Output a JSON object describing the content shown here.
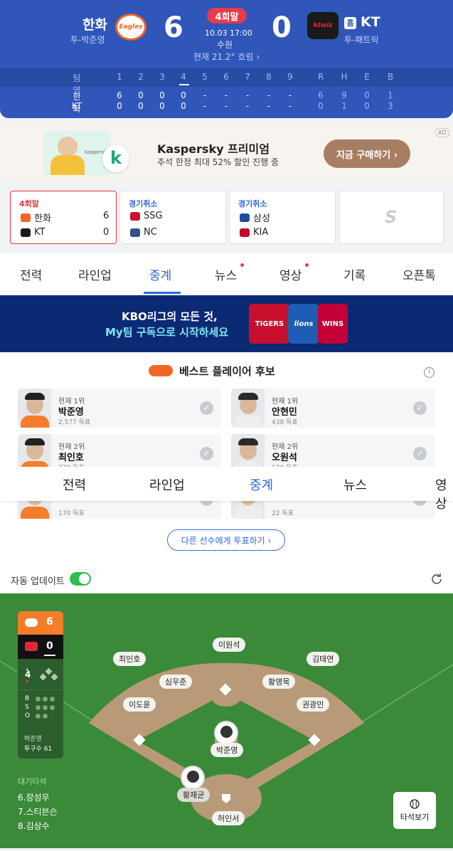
{
  "scoreboard": {
    "away": {
      "name": "한화",
      "pitcher": "투-박준영",
      "score": "6",
      "logo_text": "Eagles"
    },
    "home": {
      "name": "KT",
      "pitcher": "투-패트릭",
      "score": "0",
      "logo_text": "ktwiz",
      "home_badge": "홈"
    },
    "inning": "4회말",
    "datetime": "10.03 17:00",
    "stadium": "수원",
    "weather": "현재 21.2° 흐림 ›",
    "linescore": {
      "header": [
        "팀명",
        "1",
        "2",
        "3",
        "4",
        "5",
        "6",
        "7",
        "8",
        "9",
        "R",
        "H",
        "E",
        "B"
      ],
      "rows": [
        [
          "한화",
          "6",
          "0",
          "0",
          "0",
          "-",
          "-",
          "-",
          "-",
          "-",
          "6",
          "9",
          "0",
          "1"
        ],
        [
          "KT",
          "0",
          "0",
          "0",
          "0",
          "-",
          "-",
          "-",
          "-",
          "-",
          "0",
          "1",
          "0",
          "3"
        ]
      ]
    }
  },
  "ad": {
    "title": "Kaspersky 프리미엄",
    "subtitle": "추석 한정 최대 52% 할인 진행 중",
    "button": "지금 구매하기 ›",
    "badge": "AD",
    "brand": "kaspersky",
    "brand_mark": "k"
  },
  "games": [
    {
      "status": "4회말",
      "team1": "한화",
      "score1": "6",
      "team2": "KT",
      "score2": "0"
    },
    {
      "status": "경기취소",
      "team1": "SSG",
      "team2": "NC"
    },
    {
      "status": "경기취소",
      "team1": "삼성",
      "team2": "KIA"
    },
    {
      "status": "",
      "logo": "S"
    }
  ],
  "tabs": [
    "전력",
    "라인업",
    "중계",
    "뉴스",
    "영상",
    "기록",
    "오픈톡"
  ],
  "sticky_tabs": [
    "전력",
    "라인업",
    "중계",
    "뉴스",
    "영상"
  ],
  "banner": {
    "line1": "KBO리그의 모든 것,",
    "line2": "My팀 구독으로 시작하세요",
    "t1": "TIGERS",
    "t2": "lions",
    "t3": "WINS"
  },
  "best_players": {
    "title": "베스트 플레이어 후보",
    "cards": [
      {
        "rank": "현재 1위",
        "name": "박준영",
        "votes": "2,577 득표"
      },
      {
        "rank": "현재 1위",
        "name": "안현민",
        "votes": "438 득표"
      },
      {
        "rank": "현재 2위",
        "name": "최인호",
        "votes": "770 득표"
      },
      {
        "rank": "현재 2위",
        "name": "오원석",
        "votes": "176 득표"
      },
      {
        "rank": "",
        "name": "",
        "votes": "170 득표"
      },
      {
        "rank": "",
        "name": "",
        "votes": "22 득표"
      }
    ],
    "vote_button": "다른 선수에게 투표하기 ›"
  },
  "auto_update": {
    "label": "자동 업데이트",
    "on": true
  },
  "field": {
    "mini_score": {
      "away": "6",
      "home": "0",
      "inning": "4"
    },
    "counts": [
      "B",
      "S",
      "O"
    ],
    "pitcher": "박준영",
    "pitch_count": "투구수 61",
    "waiting_title": "대기타석",
    "waiting": [
      "6.장성우",
      "7.스티븐슨",
      "8.김상수"
    ],
    "fielders": {
      "cf": "이원석",
      "lf": "최인호",
      "rf": "김태연",
      "ss": "심우준",
      "2b": "황영묵",
      "3b": "이도윤",
      "1b": "권광민",
      "p": "박준영",
      "batter": "황재균",
      "c": "허인서"
    },
    "batter_button": "타석보기"
  }
}
